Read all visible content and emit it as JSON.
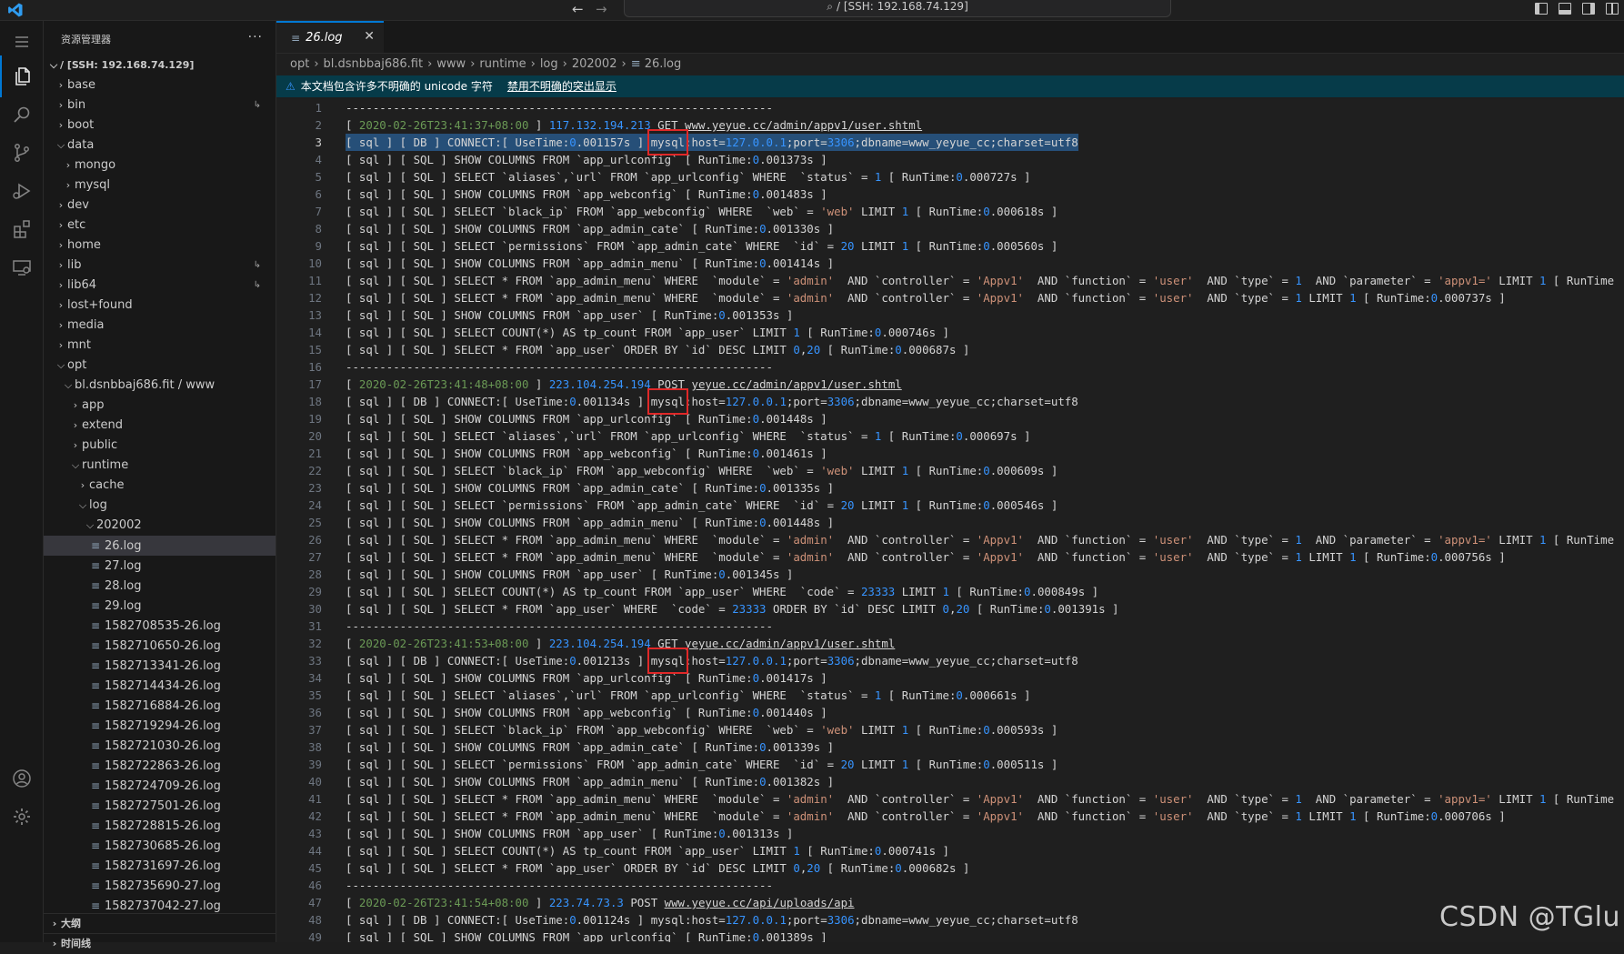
{
  "window": {
    "command_center": "/ [SSH: 192.168.74.129]"
  },
  "sidebar": {
    "title": "资源管理器",
    "more": "···",
    "root": "/ [SSH: 192.168.74.129]",
    "outline": "大纲",
    "timeline": "时间线"
  },
  "tree": [
    {
      "label": "base",
      "depth": 1,
      "type": "folder",
      "open": false
    },
    {
      "label": "bin",
      "depth": 1,
      "type": "folder",
      "open": false,
      "link": true
    },
    {
      "label": "boot",
      "depth": 1,
      "type": "folder",
      "open": false
    },
    {
      "label": "data",
      "depth": 1,
      "type": "folder",
      "open": true
    },
    {
      "label": "mongo",
      "depth": 2,
      "type": "folder",
      "open": false
    },
    {
      "label": "mysql",
      "depth": 2,
      "type": "folder",
      "open": false
    },
    {
      "label": "dev",
      "depth": 1,
      "type": "folder",
      "open": false
    },
    {
      "label": "etc",
      "depth": 1,
      "type": "folder",
      "open": false
    },
    {
      "label": "home",
      "depth": 1,
      "type": "folder",
      "open": false
    },
    {
      "label": "lib",
      "depth": 1,
      "type": "folder",
      "open": false,
      "link": true
    },
    {
      "label": "lib64",
      "depth": 1,
      "type": "folder",
      "open": false,
      "link": true
    },
    {
      "label": "lost+found",
      "depth": 1,
      "type": "folder",
      "open": false
    },
    {
      "label": "media",
      "depth": 1,
      "type": "folder",
      "open": false
    },
    {
      "label": "mnt",
      "depth": 1,
      "type": "folder",
      "open": false
    },
    {
      "label": "opt",
      "depth": 1,
      "type": "folder",
      "open": true
    },
    {
      "label": "bl.dsnbbaj686.fit / www",
      "depth": 2,
      "type": "folder",
      "open": true
    },
    {
      "label": "app",
      "depth": 3,
      "type": "folder",
      "open": false
    },
    {
      "label": "extend",
      "depth": 3,
      "type": "folder",
      "open": false
    },
    {
      "label": "public",
      "depth": 3,
      "type": "folder",
      "open": false
    },
    {
      "label": "runtime",
      "depth": 3,
      "type": "folder",
      "open": true
    },
    {
      "label": "cache",
      "depth": 4,
      "type": "folder",
      "open": false
    },
    {
      "label": "log",
      "depth": 4,
      "type": "folder",
      "open": true
    },
    {
      "label": "202002",
      "depth": 5,
      "type": "folder",
      "open": true
    },
    {
      "label": "26.log",
      "depth": 6,
      "type": "file",
      "selected": true
    },
    {
      "label": "27.log",
      "depth": 6,
      "type": "file"
    },
    {
      "label": "28.log",
      "depth": 6,
      "type": "file"
    },
    {
      "label": "29.log",
      "depth": 6,
      "type": "file"
    },
    {
      "label": "1582708535-26.log",
      "depth": 6,
      "type": "file"
    },
    {
      "label": "1582710650-26.log",
      "depth": 6,
      "type": "file"
    },
    {
      "label": "1582713341-26.log",
      "depth": 6,
      "type": "file"
    },
    {
      "label": "1582714434-26.log",
      "depth": 6,
      "type": "file"
    },
    {
      "label": "1582716884-26.log",
      "depth": 6,
      "type": "file"
    },
    {
      "label": "1582719294-26.log",
      "depth": 6,
      "type": "file"
    },
    {
      "label": "1582721030-26.log",
      "depth": 6,
      "type": "file"
    },
    {
      "label": "1582722863-26.log",
      "depth": 6,
      "type": "file"
    },
    {
      "label": "1582724709-26.log",
      "depth": 6,
      "type": "file"
    },
    {
      "label": "1582727501-26.log",
      "depth": 6,
      "type": "file"
    },
    {
      "label": "1582728815-26.log",
      "depth": 6,
      "type": "file"
    },
    {
      "label": "1582730685-26.log",
      "depth": 6,
      "type": "file"
    },
    {
      "label": "1582731697-26.log",
      "depth": 6,
      "type": "file"
    },
    {
      "label": "1582735690-27.log",
      "depth": 6,
      "type": "file"
    },
    {
      "label": "1582737042-27.log",
      "depth": 6,
      "type": "file"
    }
  ],
  "editor": {
    "tab": {
      "label": "26.log",
      "close": "✕"
    },
    "breadcrumb": [
      "opt",
      "bl.dsnbbaj686.fit",
      "www",
      "runtime",
      "log",
      "202002",
      "26.log"
    ],
    "banner": {
      "message": "本文档包含许多不明确的 unicode 字符",
      "action": "禁用不明确的突出显示"
    },
    "current_line": 3,
    "highlight_word": "mysql",
    "lines": [
      "---------------------------------------------------------------",
      "[ 2020-02-26T23:41:37+08:00 ] 117.132.194.213 GET www.yeyue.cc/admin/appv1/user.shtml",
      "[ sql ] [ DB ] CONNECT:[ UseTime:0.001157s ] mysql:host=127.0.0.1;port=3306;dbname=www_yeyue_cc;charset=utf8",
      "[ sql ] [ SQL ] SHOW COLUMNS FROM `app_urlconfig` [ RunTime:0.001373s ]",
      "[ sql ] [ SQL ] SELECT `aliases`,`url` FROM `app_urlconfig` WHERE  `status` = 1 [ RunTime:0.000727s ]",
      "[ sql ] [ SQL ] SHOW COLUMNS FROM `app_webconfig` [ RunTime:0.001483s ]",
      "[ sql ] [ SQL ] SELECT `black_ip` FROM `app_webconfig` WHERE  `web` = 'web' LIMIT 1 [ RunTime:0.000618s ]",
      "[ sql ] [ SQL ] SHOW COLUMNS FROM `app_admin_cate` [ RunTime:0.001330s ]",
      "[ sql ] [ SQL ] SELECT `permissions` FROM `app_admin_cate` WHERE  `id` = 20 LIMIT 1 [ RunTime:0.000560s ]",
      "[ sql ] [ SQL ] SHOW COLUMNS FROM `app_admin_menu` [ RunTime:0.001414s ]",
      "[ sql ] [ SQL ] SELECT * FROM `app_admin_menu` WHERE  `module` = 'admin'  AND `controller` = 'Appv1'  AND `function` = 'user'  AND `type` = 1  AND `parameter` = 'appv1=' LIMIT 1 [ RunTime",
      "[ sql ] [ SQL ] SELECT * FROM `app_admin_menu` WHERE  `module` = 'admin'  AND `controller` = 'Appv1'  AND `function` = 'user'  AND `type` = 1 LIMIT 1 [ RunTime:0.000737s ]",
      "[ sql ] [ SQL ] SHOW COLUMNS FROM `app_user` [ RunTime:0.001353s ]",
      "[ sql ] [ SQL ] SELECT COUNT(*) AS tp_count FROM `app_user` LIMIT 1 [ RunTime:0.000746s ]",
      "[ sql ] [ SQL ] SELECT * FROM `app_user` ORDER BY `id` DESC LIMIT 0,20 [ RunTime:0.000687s ]",
      "---------------------------------------------------------------",
      "[ 2020-02-26T23:41:48+08:00 ] 223.104.254.194 POST yeyue.cc/admin/appv1/user.shtml",
      "[ sql ] [ DB ] CONNECT:[ UseTime:0.001134s ] mysql:host=127.0.0.1;port=3306;dbname=www_yeyue_cc;charset=utf8",
      "[ sql ] [ SQL ] SHOW COLUMNS FROM `app_urlconfig` [ RunTime:0.001448s ]",
      "[ sql ] [ SQL ] SELECT `aliases`,`url` FROM `app_urlconfig` WHERE  `status` = 1 [ RunTime:0.000697s ]",
      "[ sql ] [ SQL ] SHOW COLUMNS FROM `app_webconfig` [ RunTime:0.001461s ]",
      "[ sql ] [ SQL ] SELECT `black_ip` FROM `app_webconfig` WHERE  `web` = 'web' LIMIT 1 [ RunTime:0.000609s ]",
      "[ sql ] [ SQL ] SHOW COLUMNS FROM `app_admin_cate` [ RunTime:0.001335s ]",
      "[ sql ] [ SQL ] SELECT `permissions` FROM `app_admin_cate` WHERE  `id` = 20 LIMIT 1 [ RunTime:0.000546s ]",
      "[ sql ] [ SQL ] SHOW COLUMNS FROM `app_admin_menu` [ RunTime:0.001448s ]",
      "[ sql ] [ SQL ] SELECT * FROM `app_admin_menu` WHERE  `module` = 'admin'  AND `controller` = 'Appv1'  AND `function` = 'user'  AND `type` = 1  AND `parameter` = 'appv1=' LIMIT 1 [ RunTime",
      "[ sql ] [ SQL ] SELECT * FROM `app_admin_menu` WHERE  `module` = 'admin'  AND `controller` = 'Appv1'  AND `function` = 'user'  AND `type` = 1 LIMIT 1 [ RunTime:0.000756s ]",
      "[ sql ] [ SQL ] SHOW COLUMNS FROM `app_user` [ RunTime:0.001345s ]",
      "[ sql ] [ SQL ] SELECT COUNT(*) AS tp_count FROM `app_user` WHERE  `code` = 23333 LIMIT 1 [ RunTime:0.000849s ]",
      "[ sql ] [ SQL ] SELECT * FROM `app_user` WHERE  `code` = 23333 ORDER BY `id` DESC LIMIT 0,20 [ RunTime:0.001391s ]",
      "---------------------------------------------------------------",
      "[ 2020-02-26T23:41:53+08:00 ] 223.104.254.194 GET yeyue.cc/admin/appv1/user.shtml",
      "[ sql ] [ DB ] CONNECT:[ UseTime:0.001213s ] mysql:host=127.0.0.1;port=3306;dbname=www_yeyue_cc;charset=utf8",
      "[ sql ] [ SQL ] SHOW COLUMNS FROM `app_urlconfig` [ RunTime:0.001417s ]",
      "[ sql ] [ SQL ] SELECT `aliases`,`url` FROM `app_urlconfig` WHERE  `status` = 1 [ RunTime:0.000661s ]",
      "[ sql ] [ SQL ] SHOW COLUMNS FROM `app_webconfig` [ RunTime:0.001440s ]",
      "[ sql ] [ SQL ] SELECT `black_ip` FROM `app_webconfig` WHERE  `web` = 'web' LIMIT 1 [ RunTime:0.000593s ]",
      "[ sql ] [ SQL ] SHOW COLUMNS FROM `app_admin_cate` [ RunTime:0.001339s ]",
      "[ sql ] [ SQL ] SELECT `permissions` FROM `app_admin_cate` WHERE  `id` = 20 LIMIT 1 [ RunTime:0.000511s ]",
      "[ sql ] [ SQL ] SHOW COLUMNS FROM `app_admin_menu` [ RunTime:0.001382s ]",
      "[ sql ] [ SQL ] SELECT * FROM `app_admin_menu` WHERE  `module` = 'admin'  AND `controller` = 'Appv1'  AND `function` = 'user'  AND `type` = 1  AND `parameter` = 'appv1=' LIMIT 1 [ RunTime",
      "[ sql ] [ SQL ] SELECT * FROM `app_admin_menu` WHERE  `module` = 'admin'  AND `controller` = 'Appv1'  AND `function` = 'user'  AND `type` = 1 LIMIT 1 [ RunTime:0.000706s ]",
      "[ sql ] [ SQL ] SHOW COLUMNS FROM `app_user` [ RunTime:0.001313s ]",
      "[ sql ] [ SQL ] SELECT COUNT(*) AS tp_count FROM `app_user` LIMIT 1 [ RunTime:0.000741s ]",
      "[ sql ] [ SQL ] SELECT * FROM `app_user` ORDER BY `id` DESC LIMIT 0,20 [ RunTime:0.000682s ]",
      "---------------------------------------------------------------",
      "[ 2020-02-26T23:41:54+08:00 ] 223.74.73.3 POST www.yeyue.cc/api/uploads/api",
      "[ sql ] [ DB ] CONNECT:[ UseTime:0.001124s ] mysql:host=127.0.0.1;port=3306;dbname=www_yeyue_cc;charset=utf8",
      "[ sql ] [ SQL ] SHOW COLUMNS FROM `app_urlconfig` [ RunTime:0.001389s ]"
    ],
    "boxed_lines": [
      3,
      18,
      33
    ]
  },
  "watermark": "CSDN @TGlu",
  "colors": {
    "accent": "#0078d4",
    "box": "#e02828",
    "number": "#3794ff",
    "string": "#ce9178",
    "timestamp": "#6a9955"
  }
}
